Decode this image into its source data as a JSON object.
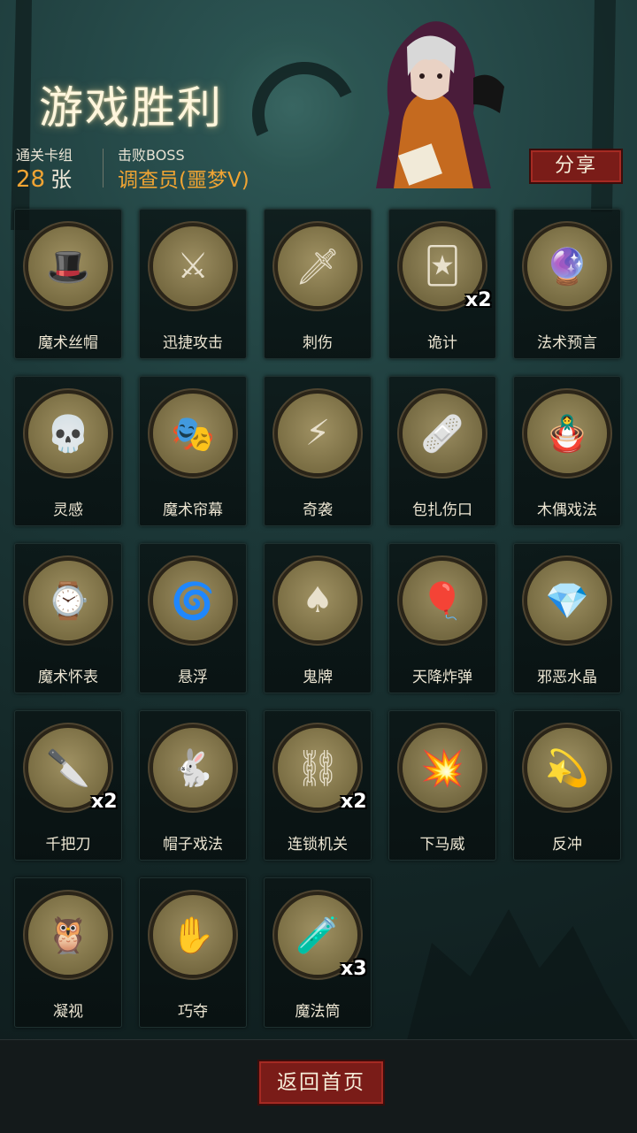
{
  "header": {
    "title": "游戏胜利",
    "cleared_deck_label": "通关卡组",
    "cleared_deck_count": "28",
    "cleared_deck_unit": "张",
    "boss_label": "击败BOSS",
    "boss_name": "调查员(噩梦V)",
    "share_label": "分享"
  },
  "cards": [
    {
      "name": "魔术丝帽",
      "icon": "top-hat-icon",
      "count": ""
    },
    {
      "name": "迅捷攻击",
      "icon": "swift-strike-icon",
      "count": ""
    },
    {
      "name": "刺伤",
      "icon": "dagger-icon",
      "count": ""
    },
    {
      "name": "诡计",
      "icon": "trickster-icon",
      "count": "x2"
    },
    {
      "name": "法术预言",
      "icon": "crystal-orb-icon",
      "count": ""
    },
    {
      "name": "灵感",
      "icon": "brain-skull-icon",
      "count": ""
    },
    {
      "name": "魔术帘幕",
      "icon": "curtain-hat-icon",
      "count": ""
    },
    {
      "name": "奇袭",
      "icon": "ambush-icon",
      "count": ""
    },
    {
      "name": "包扎伤口",
      "icon": "plague-doctor-icon",
      "count": ""
    },
    {
      "name": "木偶戏法",
      "icon": "puppet-icon",
      "count": ""
    },
    {
      "name": "魔术怀表",
      "icon": "pocket-watch-icon",
      "count": ""
    },
    {
      "name": "悬浮",
      "icon": "levitate-icon",
      "count": ""
    },
    {
      "name": "鬼牌",
      "icon": "joker-skull-icon",
      "count": ""
    },
    {
      "name": "天降炸弹",
      "icon": "balloon-bomb-icon",
      "count": ""
    },
    {
      "name": "邪恶水晶",
      "icon": "evil-crystal-icon",
      "count": ""
    },
    {
      "name": "千把刀",
      "icon": "thousand-knives-icon",
      "count": "x2"
    },
    {
      "name": "帽子戏法",
      "icon": "rabbit-hat-icon",
      "count": ""
    },
    {
      "name": "连锁机关",
      "icon": "chain-trap-icon",
      "count": "x2"
    },
    {
      "name": "下马威",
      "icon": "intimidate-icon",
      "count": ""
    },
    {
      "name": "反冲",
      "icon": "recoil-icon",
      "count": ""
    },
    {
      "name": "凝视",
      "icon": "owl-icon",
      "count": ""
    },
    {
      "name": "巧夺",
      "icon": "snatch-icon",
      "count": ""
    },
    {
      "name": "魔法筒",
      "icon": "magic-tube-icon",
      "count": "x3"
    }
  ],
  "footer": {
    "home_label": "返回首页"
  }
}
